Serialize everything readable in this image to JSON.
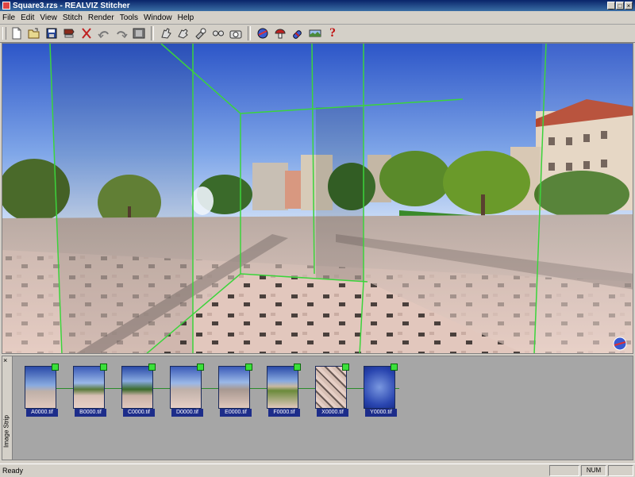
{
  "window": {
    "title": "Square3.rzs - REALVIZ Stitcher",
    "controls": [
      "_",
      "□",
      "×"
    ]
  },
  "menu": [
    "File",
    "Edit",
    "View",
    "Stitch",
    "Render",
    "Tools",
    "Window",
    "Help"
  ],
  "toolbar": {
    "groups": [
      [
        "new-icon",
        "open-icon",
        "save-icon",
        "tape-icon",
        "cut-icon",
        "undo-icon",
        "redo-icon",
        "film-icon"
      ],
      [
        "stitch-hand-icon",
        "stitch-hand-alt-icon",
        "pin-icon",
        "glasses-icon",
        "camera-icon"
      ],
      [
        "sphere-icon",
        "mushroom-icon",
        "pill-icon",
        "panorama-icon",
        "help-icon"
      ]
    ],
    "help_glyph": "?"
  },
  "image_strip": {
    "label": "Image Strip",
    "close": "×",
    "thumbnails": [
      {
        "name": "A0000.tif",
        "scene": "fountain"
      },
      {
        "name": "B0000.tif",
        "scene": "tree"
      },
      {
        "name": "C0000.tif",
        "scene": "tree-sky"
      },
      {
        "name": "D0000.tif",
        "scene": "plaza"
      },
      {
        "name": "E0000.tif",
        "scene": "plaza-shadow"
      },
      {
        "name": "F0000.tif",
        "scene": "buildings"
      },
      {
        "name": "X0000.tif",
        "scene": "ground"
      },
      {
        "name": "Y0000.tif",
        "scene": "sky"
      }
    ]
  },
  "status": {
    "text": "Ready",
    "panes": [
      "",
      "NUM",
      ""
    ]
  },
  "colors": {
    "overlap_lines": "#3bd43b",
    "caption_bg": "#1d2d8a"
  }
}
